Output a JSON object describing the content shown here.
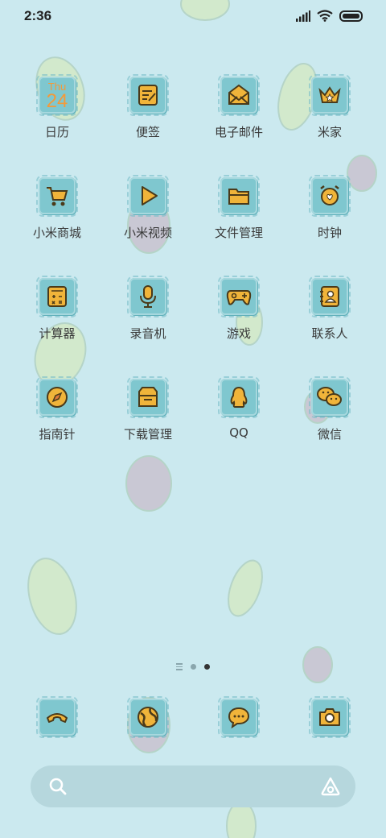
{
  "status": {
    "time": "2:36"
  },
  "colors": {
    "background": "#cbe9ef",
    "tile": "#7fc7cf",
    "icon": "#f0b43a",
    "outline": "#4a3a1a"
  },
  "calendar": {
    "weekday": "Thu",
    "date": "24"
  },
  "apps": [
    {
      "label": "日历",
      "icon": "calendar-icon"
    },
    {
      "label": "便签",
      "icon": "notes-icon"
    },
    {
      "label": "电子邮件",
      "icon": "mail-icon"
    },
    {
      "label": "米家",
      "icon": "crown-home-icon"
    },
    {
      "label": "小米商城",
      "icon": "cart-icon"
    },
    {
      "label": "小米视频",
      "icon": "play-icon"
    },
    {
      "label": "文件管理",
      "icon": "folder-icon"
    },
    {
      "label": "时钟",
      "icon": "alarm-clock-icon"
    },
    {
      "label": "计算器",
      "icon": "calculator-icon"
    },
    {
      "label": "录音机",
      "icon": "microphone-icon"
    },
    {
      "label": "游戏",
      "icon": "gamepad-icon"
    },
    {
      "label": "联系人",
      "icon": "contacts-icon"
    },
    {
      "label": "指南针",
      "icon": "compass-icon"
    },
    {
      "label": "下载管理",
      "icon": "download-box-icon"
    },
    {
      "label": "QQ",
      "icon": "qq-penguin-icon"
    },
    {
      "label": "微信",
      "icon": "wechat-icon"
    }
  ],
  "dock": [
    {
      "icon": "phone-icon"
    },
    {
      "icon": "browser-globe-icon"
    },
    {
      "icon": "messages-icon"
    },
    {
      "icon": "camera-icon"
    }
  ],
  "pager": {
    "pages": 2,
    "current": 2
  }
}
